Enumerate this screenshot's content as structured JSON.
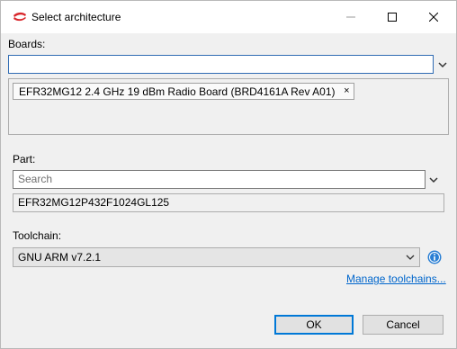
{
  "window": {
    "title": "Select architecture"
  },
  "boards": {
    "label": "Boards:",
    "input_value": "",
    "selected_chip": "EFR32MG12 2.4 GHz 19 dBm Radio Board (BRD4161A Rev A01)",
    "chip_remove": "×"
  },
  "part": {
    "label": "Part:",
    "search_placeholder": "Search",
    "value": "EFR32MG12P432F1024GL125"
  },
  "toolchain": {
    "label": "Toolchain:",
    "selected": "GNU ARM v7.2.1",
    "manage_link": "Manage toolchains..."
  },
  "buttons": {
    "ok": "OK",
    "cancel": "Cancel"
  },
  "colors": {
    "accent": "#0078d7",
    "link": "#0066cc",
    "info": "#2a7fd4"
  }
}
